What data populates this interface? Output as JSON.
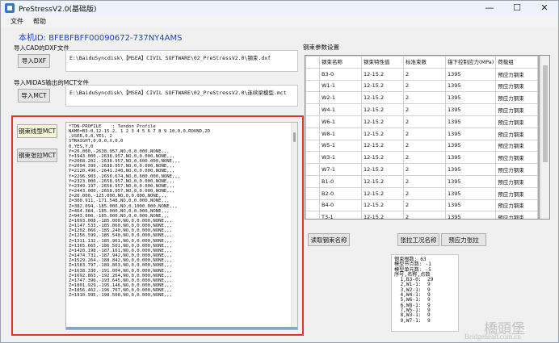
{
  "window": {
    "title": "PreStressV2.0(基础版)",
    "controls": {
      "minimize": "—",
      "maximize": "☐",
      "close": "✕"
    }
  },
  "menu": [
    "文件",
    "帮助"
  ],
  "machine_id": "本机ID:  BFEBFBFF00090672-737NY4AMS",
  "import_dxf": {
    "label": "导入CAD的DXF文件",
    "button": "导入DXF",
    "path": "E:\\BaiduSyncdisk\\【MSEA】CIVIL SOFTWARE\\02_PreStressV2.0\\钢束.dxf"
  },
  "import_mct": {
    "label": "导入MIDAS输出的MCT文件",
    "button": "导入MCT",
    "path": "E:\\BaiduSyncdisk\\【MSEA】CIVIL SOFTWARE\\02_PreStressV2.0\\连续梁模型.mct"
  },
  "tendon_shape_mct_button": "钢束线型MCT",
  "tendon_tension_mct_button": "钢束张拉MCT",
  "mct_lines": [
    "*TDN-PROFILE    ; Tendon Profile",
    "NAME=B3-0,12-15.2, 1 2 3 4 5 6 7 8 9 10,0,0,ROUND,2D",
    ",USER,0,0,YES, 2",
    "STRAIGHT,0,0,0,X,0,0",
    "0,YES,Y,0",
    "Y=20.000,-2638.957,NO,0,0.000,NONE,,,",
    "Y=1943.000,-2638.957,NO,0,0.000,NONE,,,",
    "Y=2068.202,-2638.957,NO,0,600.000,NONE,,,",
    "Y=2094.399,-2638.957,NO,0,0.000,NONE,,,",
    "Y=2120.496,-2641.240,NO,0,0.000,NONE,,,",
    "Y=2296.903,-2656.674,NO,0,600.000,NONE,,,",
    "Y=2323.000,-2658.957,NO,0,0.000,NONE,,,",
    "Y=2349.197,-2658.957,NO,0,0.000,NONE,,,",
    "Y=2443.000,-2658.957,NO,0,0.000,NONE,,,",
    "Z=20.000,-125.000,NO,0,0.000,NONE,,,",
    "Z=300.911,-171.548,NO,0,0.000,NONE,,,",
    "Z=382.094,-185.000,NO,0,1000.000,NONE,,,",
    "Z=464.384,-185.000,NO,0,0.000,NONE,,,",
    "Z=943.000,-185.000,NO,0,0.000,NONE,,,",
    "Z=1093.008,-185.000,NO,0,0.000,NONE,,,",
    "Z=1147.533,-185.060,NO,0,0.000,NONE,,,",
    "Z=1202.066,-185.240,NO,0,0.000,NONE,,,",
    "Z=1256.599,-185.540,NO,0,0.000,NONE,,,",
    "Z=1311.132,-185.961,NO,0,0.000,NONE,,,",
    "Z=1365.665,-186.501,NO,0,0.000,NONE,,,",
    "Z=1420.198,-187.161,NO,0,0.000,NONE,,,",
    "Z=1474.731,-187.942,NO,0,0.000,NONE,,,",
    "Z=1529.264,-188.842,NO,0,0.000,NONE,,,",
    "Z=1583.797,-189.863,NO,0,0.000,NONE,,,",
    "Z=1638.330,-191.004,NO,0,0.000,NONE,,,",
    "Z=1692.863,-192.264,NO,0,0.000,NONE,,,",
    "Z=1747.396,-193.645,NO,0,0.000,NONE,,,",
    "Z=1801.929,-195.146,NO,0,0.000,NONE,,,",
    "Z=1856.462,-196.767,NO,0,0.000,NONE,,,",
    "Z=1910.995,-198.508,NO,0,0.000,NONE,,,"
  ],
  "tendon_params": {
    "label": "钢束参数设置",
    "columns": [
      "钢束名称",
      "钢束特性值",
      "标准束数",
      "锚下控制应力(MPa)",
      "荷载组"
    ],
    "rows": [
      [
        "B3-0",
        "12-15.2",
        "2",
        "1395",
        "预应力钢束"
      ],
      [
        "W1-1",
        "12-15.2",
        "2",
        "1395",
        "预应力钢束"
      ],
      [
        "W2-1",
        "12-15.2",
        "2",
        "1395",
        "预应力钢束"
      ],
      [
        "W4-1",
        "12-15.2",
        "2",
        "1395",
        "预应力钢束"
      ],
      [
        "W6-1",
        "12-15.2",
        "2",
        "1395",
        "预应力钢束"
      ],
      [
        "W8-1",
        "12-15.2",
        "2",
        "1395",
        "预应力钢束"
      ],
      [
        "W5-1",
        "12-15.2",
        "2",
        "1395",
        "预应力钢束"
      ],
      [
        "W3-1",
        "12-15.2",
        "2",
        "1395",
        "预应力钢束"
      ],
      [
        "W7-1",
        "12-15.2",
        "2",
        "1395",
        "预应力钢束"
      ],
      [
        "B1-0",
        "12-15.2",
        "2",
        "1395",
        "预应力钢束"
      ],
      [
        "B2-0",
        "12-15.2",
        "2",
        "1395",
        "预应力钢束"
      ],
      [
        "B4-0",
        "12-15.2",
        "2",
        "1395",
        "预应力钢束"
      ],
      [
        "T3-1",
        "12-15.2",
        "2",
        "1395",
        "预应力钢束"
      ]
    ]
  },
  "read_tendon_name_button": "读取钢束名称",
  "tension_case_button": "张拉工况名称",
  "prestress_tension_button": "预应力张拉",
  "log_lines": [
    "钢束根数: 63",
    "模型节点数: -1",
    "模型单元数: -5",
    "序号,名称,点数",
    "  1,B3-0:  29",
    "  2,W1-1:  9",
    "  3,W2-1:  9",
    "  4,W4-1:  9",
    "  5,W6-1:  9",
    "  6,W8-1:  9",
    "  7,W5-1:  9",
    "  8,W3-1:  9",
    "  9,W7-1:  9"
  ],
  "watermark": {
    "cn": "橋頭堡",
    "en": "Bridgehead.com.cn"
  }
}
